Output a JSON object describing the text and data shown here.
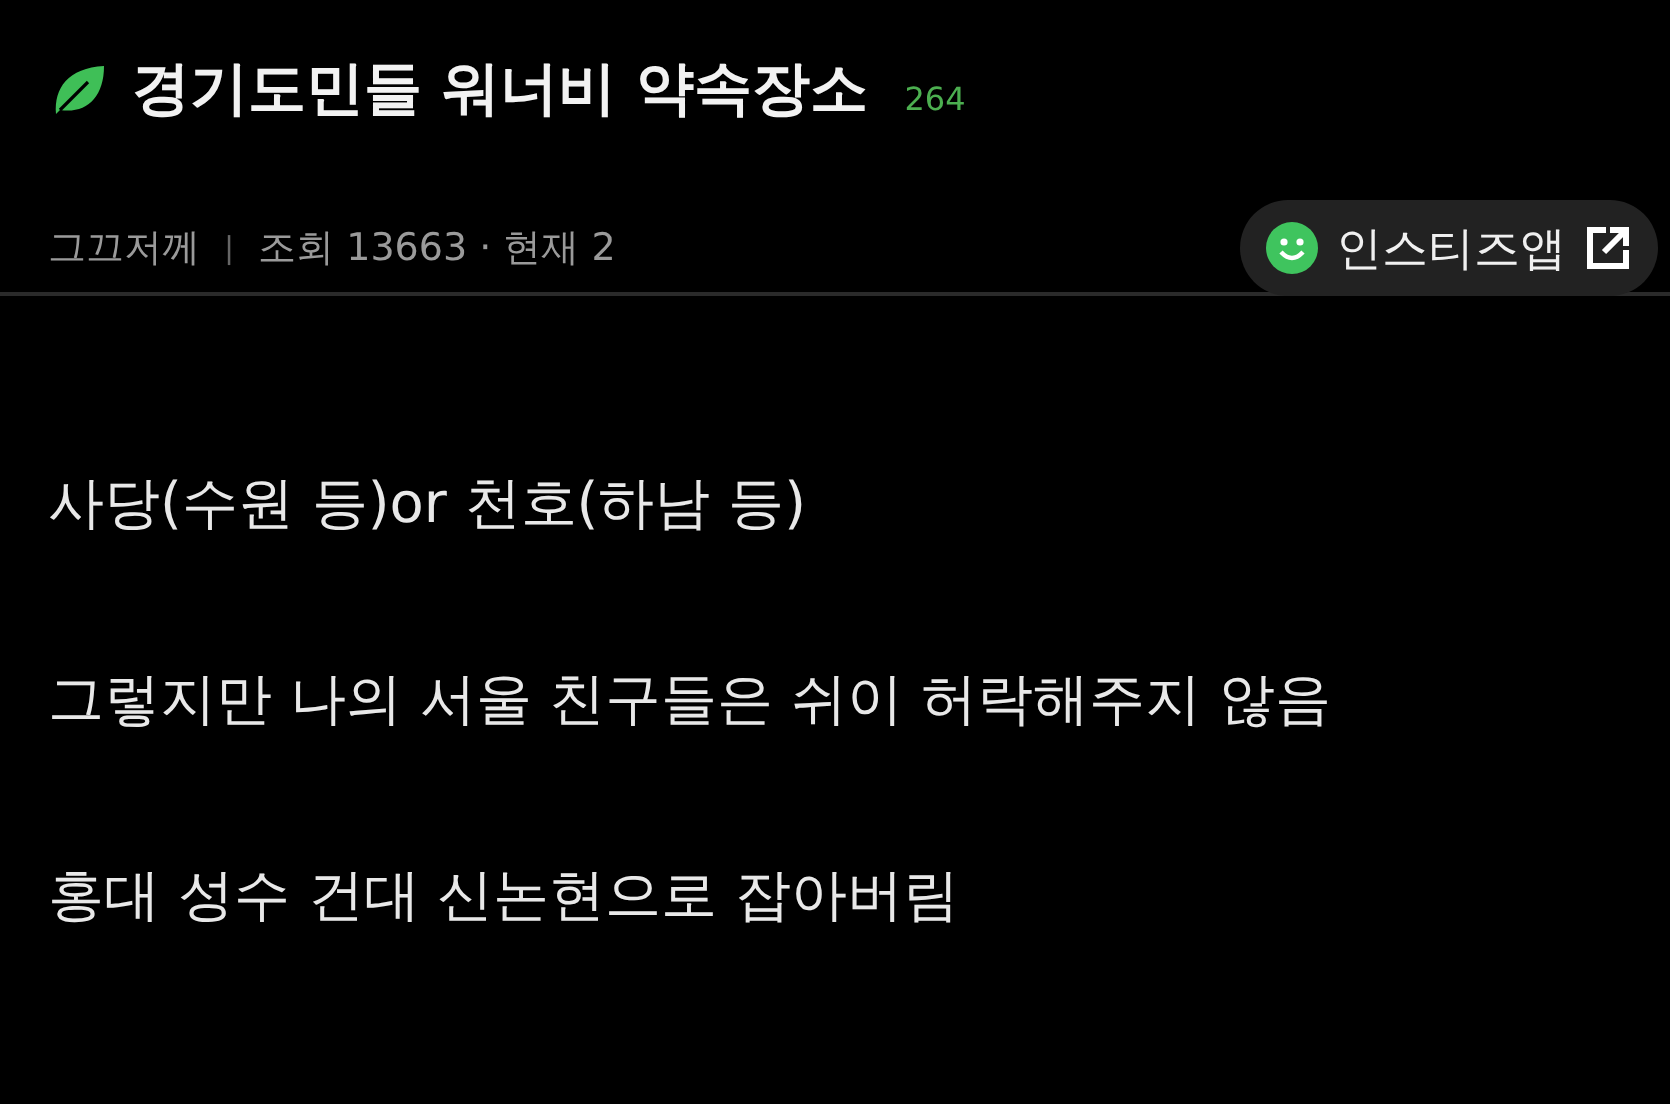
{
  "post": {
    "title": "경기도민들 워너비 약속장소",
    "comment_count": "264",
    "author": "그끄저께",
    "separator": "|",
    "stats": "조회 13663 · 현재 2"
  },
  "app_button": {
    "label": "인스티즈앱"
  },
  "body": [
    "사당(수원 등)or 천호(하남 등)",
    "그렇지만 나의 서울 친구들은 쉬이 허락해주지 않음",
    "홍대 성수 건대 신논현으로 잡아버림"
  ]
}
